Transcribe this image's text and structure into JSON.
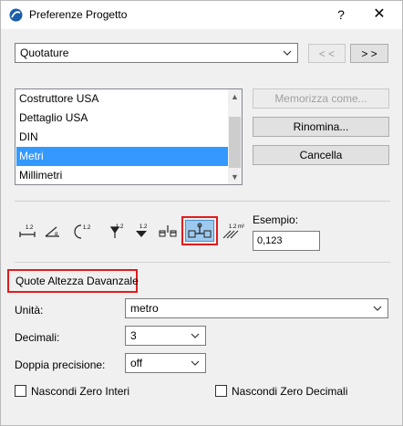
{
  "window": {
    "title": "Preferenze Progetto",
    "help_label": "?",
    "close_label": "✕"
  },
  "category_select": {
    "value": "Quotature"
  },
  "nav": {
    "prev_label": "< <",
    "next_label": "> >"
  },
  "list": {
    "items": [
      {
        "label": "Costruttore USA"
      },
      {
        "label": "Dettaglio USA"
      },
      {
        "label": "DIN"
      },
      {
        "label": "Metri",
        "selected": true
      },
      {
        "label": "Millimetri"
      }
    ]
  },
  "actions": {
    "store_label": "Memorizza come...",
    "rename_label": "Rinomina...",
    "delete_label": "Cancella"
  },
  "format_icons": {
    "labels": [
      "1.2",
      "1.2",
      "1.2",
      "1.2",
      "1.2",
      "1.2 m²"
    ],
    "selected_index": 6
  },
  "example": {
    "label": "Esempio:",
    "value": "0,123"
  },
  "section": {
    "title": "Quote Altezza Davanzale"
  },
  "fields": {
    "unit": {
      "label": "Unità:",
      "value": "metro"
    },
    "decimals": {
      "label": "Decimali:",
      "value": "3"
    },
    "double_precision": {
      "label": "Doppia precisione:",
      "value": "off"
    }
  },
  "checkboxes": {
    "hide_zero_int": {
      "label": "Nascondi Zero Interi",
      "checked": false
    },
    "hide_zero_dec": {
      "label": "Nascondi Zero Decimali",
      "checked": false
    }
  },
  "colors": {
    "selection": "#3399ff",
    "highlight_border": "#e01c1c",
    "icon_selected_bg": "#9ec9ef"
  }
}
